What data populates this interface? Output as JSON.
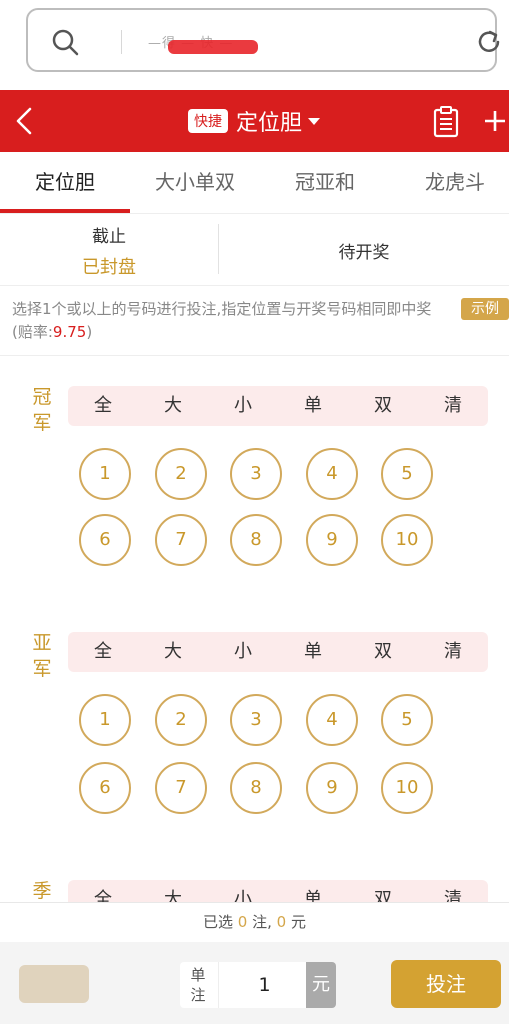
{
  "urlbar": {
    "text": "—得 — 快 —"
  },
  "header": {
    "badge": "快捷",
    "title": "定位胆"
  },
  "tabs": [
    {
      "label": "定位胆"
    },
    {
      "label": "大小单双"
    },
    {
      "label": "冠亚和"
    },
    {
      "label": "龙虎斗"
    }
  ],
  "status": {
    "deadline_label": "截止",
    "deadline_value": "已封盘",
    "draw_label": "待开奖"
  },
  "info": {
    "text": "选择1个或以上的号码进行投注,指定位置与开奖号码相同即中奖 (赔率:",
    "odds": "9.75",
    "close": ")",
    "example": "示例"
  },
  "quick_picks": [
    "全",
    "大",
    "小",
    "单",
    "双",
    "清"
  ],
  "sections": [
    {
      "label": "冠军",
      "balls": [
        "1",
        "2",
        "3",
        "4",
        "5",
        "6",
        "7",
        "8",
        "9",
        "10"
      ]
    },
    {
      "label": "亚军",
      "balls": [
        "1",
        "2",
        "3",
        "4",
        "5",
        "6",
        "7",
        "8",
        "9",
        "10"
      ]
    },
    {
      "label": "季"
    }
  ],
  "selected": {
    "prefix": "已选",
    "count": "0",
    "mid": "注,",
    "amount": "0",
    "suffix": "元"
  },
  "bottom": {
    "unit_label_1": "单",
    "unit_label_2": "注",
    "unit_value": "1",
    "unit_currency": "元",
    "submit": "投注"
  },
  "colors": {
    "header_red": "#d81e1e",
    "gold": "#c9982b",
    "quickpick_bg": "#fcebeb"
  }
}
